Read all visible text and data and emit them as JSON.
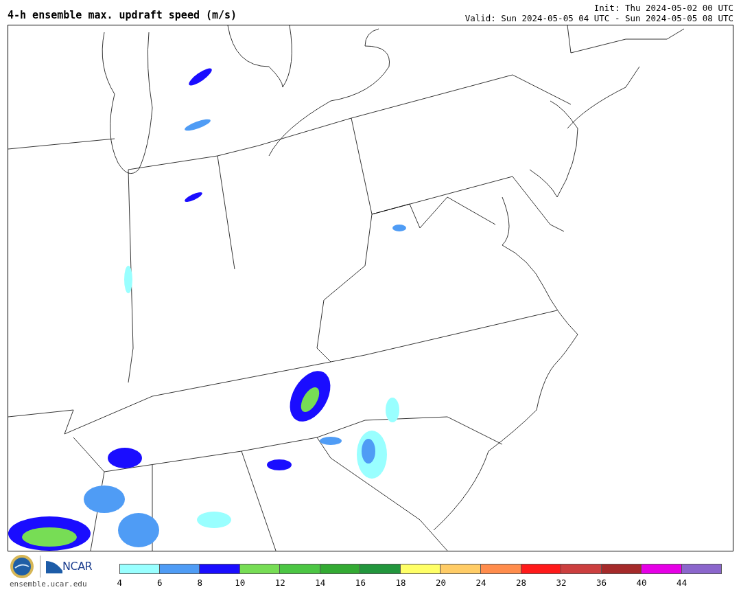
{
  "header": {
    "title": "4-h ensemble max. updraft speed (m/s)",
    "init": "Init: Thu 2024-05-02 00 UTC",
    "valid": "Valid: Sun 2024-05-05 04 UTC - Sun 2024-05-05 08 UTC"
  },
  "footer": {
    "logo_text": "NCAR",
    "site": "ensemble.ucar.edu"
  },
  "colorbar": {
    "bins": [
      {
        "color": "#99ffff",
        "tick": "4"
      },
      {
        "color": "#4f9cf5",
        "tick": "6"
      },
      {
        "color": "#1a0dff",
        "tick": "8"
      },
      {
        "color": "#77dd55",
        "tick": "10"
      },
      {
        "color": "#4cc644",
        "tick": "12"
      },
      {
        "color": "#33aa33",
        "tick": "14"
      },
      {
        "color": "#22963d",
        "tick": "16"
      },
      {
        "color": "#ffff66",
        "tick": "18"
      },
      {
        "color": "#ffcc66",
        "tick": "20"
      },
      {
        "color": "#ff8c4c",
        "tick": "24"
      },
      {
        "color": "#ff1a1a",
        "tick": "28"
      },
      {
        "color": "#cc3f3f",
        "tick": "32"
      },
      {
        "color": "#a52a2a",
        "tick": "36"
      },
      {
        "color": "#e600e6",
        "tick": "40"
      },
      {
        "color": "#8b66cc",
        "tick": "44"
      }
    ]
  }
}
